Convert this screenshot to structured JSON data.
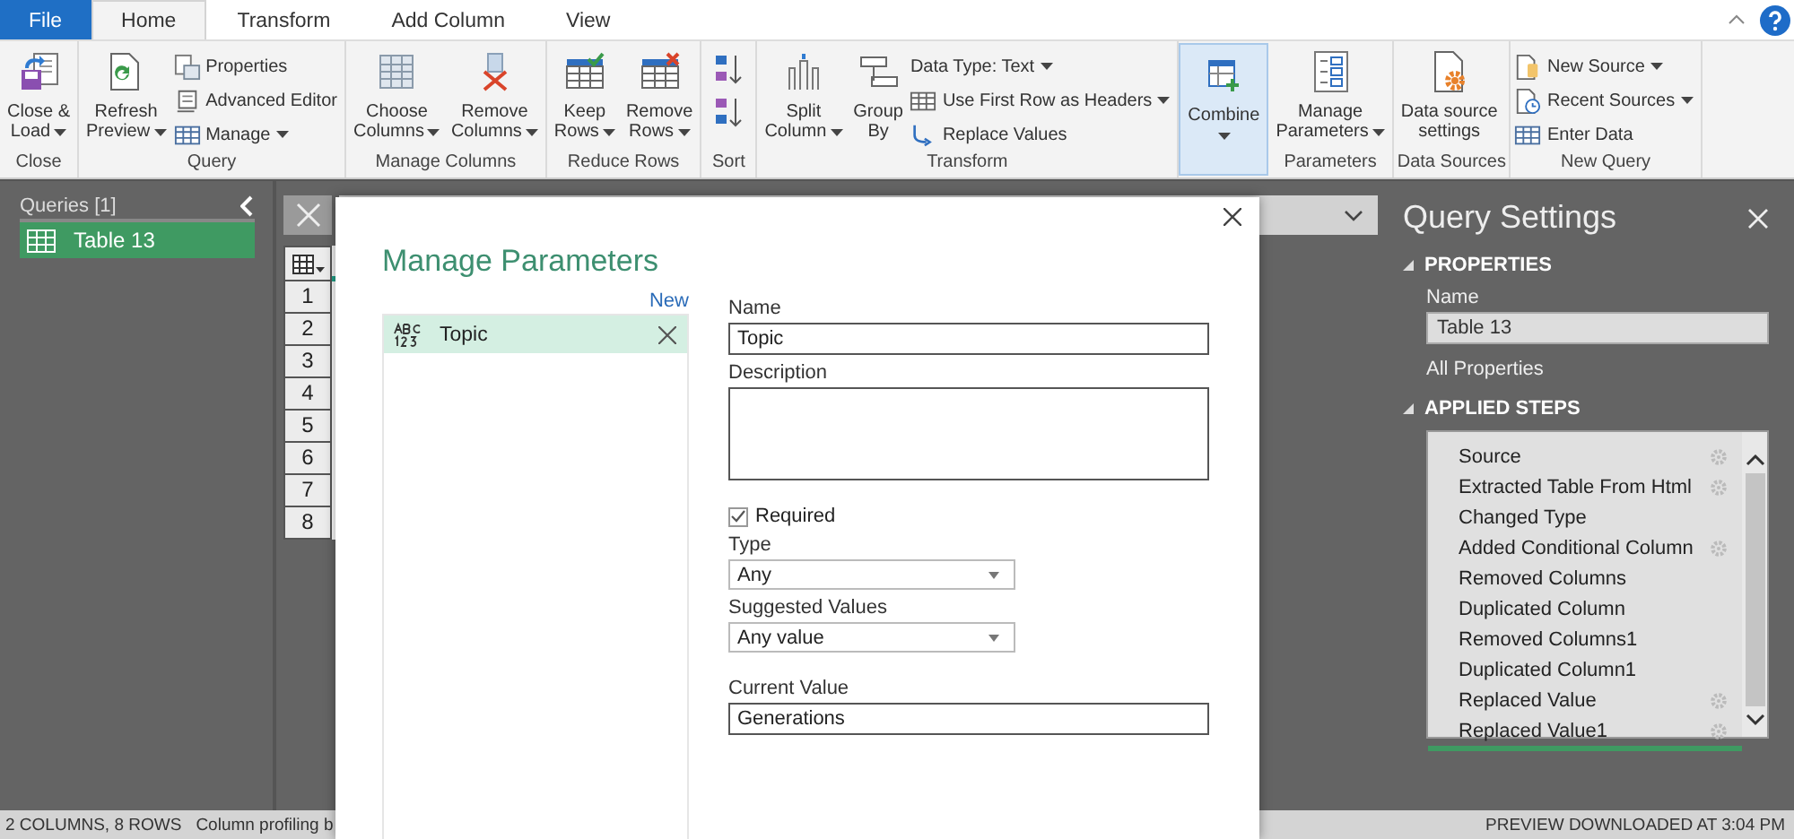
{
  "tabs": [
    {
      "label": "File",
      "kind": "file",
      "selected": false
    },
    {
      "label": "Home",
      "kind": "tab",
      "selected": true
    },
    {
      "label": "Transform",
      "kind": "tab",
      "selected": false
    },
    {
      "label": "Add Column",
      "kind": "tab",
      "selected": false
    },
    {
      "label": "View",
      "kind": "tab",
      "selected": false
    }
  ],
  "ribbon": {
    "groups": [
      {
        "label": "Close",
        "kind": "buttons",
        "highlighted": false,
        "large": [
          {
            "lines": [
              "Close &",
              "Load"
            ],
            "dropdown": true
          }
        ]
      },
      {
        "label": "Query",
        "kind": "buttons",
        "highlighted": false,
        "large": [
          {
            "lines": [
              "Refresh",
              "Preview"
            ],
            "dropdown": true
          }
        ],
        "small": [
          {
            "label": "Properties",
            "dropdown": false
          },
          {
            "label": "Advanced Editor",
            "dropdown": false
          },
          {
            "label": "Manage",
            "dropdown": true
          }
        ]
      },
      {
        "label": "Manage Columns",
        "kind": "buttons",
        "highlighted": false,
        "large": [
          {
            "lines": [
              "Choose",
              "Columns"
            ],
            "dropdown": true
          },
          {
            "lines": [
              "Remove",
              "Columns"
            ],
            "dropdown": true
          }
        ]
      },
      {
        "label": "Reduce Rows",
        "kind": "buttons",
        "highlighted": false,
        "large": [
          {
            "lines": [
              "Keep",
              "Rows"
            ],
            "dropdown": true
          },
          {
            "lines": [
              "Remove",
              "Rows"
            ],
            "dropdown": true
          }
        ]
      },
      {
        "label": "Sort",
        "kind": "sort",
        "highlighted": false
      },
      {
        "label": "Transform",
        "kind": "buttons",
        "highlighted": false,
        "large": [
          {
            "lines": [
              "Split",
              "Column"
            ],
            "dropdown": true
          },
          {
            "lines": [
              "Group",
              "By"
            ],
            "dropdown": false
          }
        ],
        "small": [
          {
            "label": "Data Type: Text",
            "dropdown": true
          },
          {
            "label": "Use First Row as Headers",
            "dropdown": true
          },
          {
            "label": "Replace Values",
            "dropdown": false
          }
        ]
      },
      {
        "kind": "buttons",
        "highlighted": true,
        "large": [
          {
            "lines": [
              "Combine"
            ],
            "dropdown": true
          }
        ]
      },
      {
        "label": "Parameters",
        "kind": "buttons",
        "highlighted": false,
        "large": [
          {
            "lines": [
              "Manage",
              "Parameters"
            ],
            "dropdown": true
          }
        ]
      },
      {
        "label": "Data Sources",
        "kind": "buttons",
        "highlighted": false,
        "large": [
          {
            "lines": [
              "Data source",
              "settings"
            ],
            "dropdown": false
          }
        ]
      },
      {
        "label": "New Query",
        "kind": "buttons",
        "highlighted": false,
        "small": [
          {
            "label": "New Source",
            "dropdown": true
          },
          {
            "label": "Recent Sources",
            "dropdown": true
          },
          {
            "label": "Enter Data",
            "dropdown": false
          }
        ]
      }
    ]
  },
  "queries": {
    "title": "Queries [1]",
    "items": [
      {
        "label": "Table 13",
        "selected": true
      }
    ]
  },
  "grid": {
    "row_numbers": [
      "1",
      "2",
      "3",
      "4",
      "5",
      "6",
      "7",
      "8"
    ]
  },
  "dialog": {
    "title": "Manage Parameters",
    "new_link": "New",
    "parameters": [
      {
        "label": "Topic",
        "selected": true
      }
    ],
    "form": {
      "name_label": "Name",
      "name_value": "Topic",
      "description_label": "Description",
      "required": {
        "label": "Required",
        "checked": true
      },
      "type_label": "Type",
      "type_value": "Any",
      "suggested_label": "Suggested Values",
      "suggested_value": "Any value",
      "current_label": "Current Value",
      "current_value": "Generations"
    }
  },
  "query_settings": {
    "title": "Query Settings",
    "properties_heading": "PROPERTIES",
    "name_label": "Name",
    "name_value": "Table 13",
    "all_properties": "All Properties",
    "steps_heading": "APPLIED STEPS",
    "steps": [
      {
        "label": "Source",
        "gear": true,
        "selected": false
      },
      {
        "label": "Extracted Table From Html",
        "gear": true,
        "selected": false
      },
      {
        "label": "Changed Type",
        "gear": false,
        "selected": false
      },
      {
        "label": "Added Conditional Column",
        "gear": true,
        "selected": false
      },
      {
        "label": "Removed Columns",
        "gear": false,
        "selected": false
      },
      {
        "label": "Duplicated Column",
        "gear": false,
        "selected": false
      },
      {
        "label": "Removed Columns1",
        "gear": false,
        "selected": false
      },
      {
        "label": "Duplicated Column1",
        "gear": false,
        "selected": false
      },
      {
        "label": "Replaced Value",
        "gear": true,
        "selected": false
      },
      {
        "label": "Replaced Value1",
        "gear": true,
        "selected": true
      }
    ]
  },
  "status_bar": {
    "summary": "2 COLUMNS, 8 ROWS",
    "profiling": "Column profiling b",
    "preview": "PREVIEW DOWNLOADED AT 3:04 PM"
  }
}
